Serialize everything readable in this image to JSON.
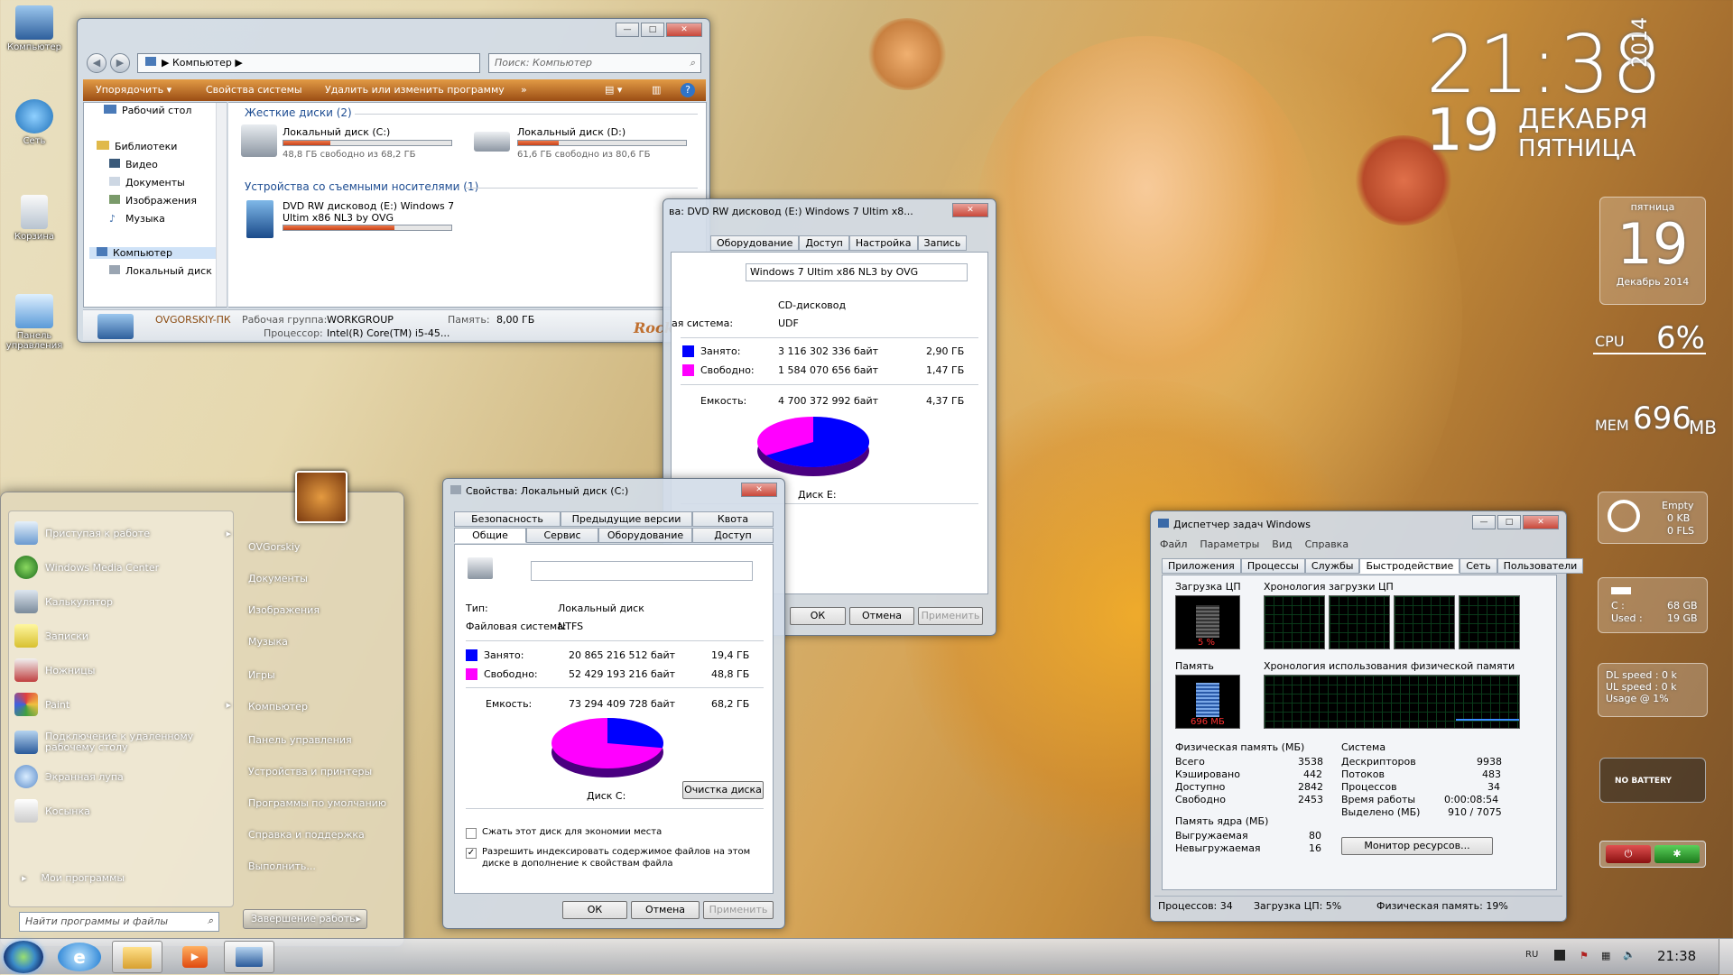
{
  "desktop": {
    "icons": [
      {
        "label": "Компьютер"
      },
      {
        "label": "Сеть"
      },
      {
        "label": "Корзина"
      },
      {
        "label": "Панель управления"
      }
    ],
    "clock": {
      "time": "21:38",
      "day": "19",
      "month": "ДЕКАБРЯ",
      "weekday": "ПЯТНИЦА",
      "year": "2014"
    },
    "calendar": {
      "weekday": "пятница",
      "day": "19",
      "month_year": "Декабрь 2014"
    },
    "cpu_gadget": {
      "label": "CPU",
      "value": "6%"
    },
    "mem_gadget": {
      "label": "MEM",
      "value": "696",
      "unit": "MB"
    },
    "recycle_gadget": {
      "line1": "Empty",
      "line2": "0 KB",
      "line3": "0 FLS"
    },
    "drive_gadget": {
      "line1": "C :",
      "line1_val": "68 GB",
      "line2": "Used :",
      "line2_val": "19 GB"
    },
    "net_gadget": {
      "line1": "DL speed : 0 k",
      "line2": "UL speed : 0 k",
      "line3": "Usage @ 1%"
    },
    "battery_gadget": {
      "label": "NO BATTERY"
    }
  },
  "explorer": {
    "address": "Компьютер",
    "search_placeholder": "Поиск: Компьютер",
    "toolbar": {
      "organize": "Упорядочить ▾",
      "system_props": "Свойства системы",
      "uninstall": "Удалить или изменить программу",
      "more": "»"
    },
    "nav": [
      "Рабочий стол",
      "Библиотеки",
      "Видео",
      "Документы",
      "Изображения",
      "Музыка",
      "Компьютер",
      "Локальный диск"
    ],
    "hdd_group": "Жесткие диски (2)",
    "drive_c": {
      "name": "Локальный диск (C:)",
      "free": "48,8 ГБ свободно из 68,2 ГБ",
      "used": 0.28
    },
    "drive_d": {
      "name": "Локальный диск (D:)",
      "free": "61,6 ГБ свободно из 80,6 ГБ",
      "used": 0.24
    },
    "removable_group": "Устройства со съемными носителями (1)",
    "dvd": {
      "name1": "DVD RW дисковод (E:) Windows 7",
      "name2": "Ultim x86 NL3 by OVG",
      "used": 0.66
    },
    "details": {
      "pc_name": "OVGORSKIY-ПК",
      "workgroup_label": "Рабочая группа:",
      "workgroup": "WORKGROUP",
      "memory_label": "Память:",
      "memory": "8,00 ГБ",
      "cpu_label": "Процессор:",
      "cpu": "Intel(R) Core(TM) i5-45..."
    },
    "brand": "Rocks"
  },
  "dvd_props": {
    "title": "ва: DVD RW дисковод (E:) Windows 7 Ultim x8...",
    "tabs": [
      "Оборудование",
      "Доступ",
      "Настройка",
      "Запись"
    ],
    "label_value": "Windows 7 Ultim x86 NL3 by OVG",
    "type": "CD-дисковод",
    "fs_label": "ая система:",
    "fs": "UDF",
    "used_label": "Занято:",
    "used_bytes": "3 116 302 336 байт",
    "used_gb": "2,90 ГБ",
    "free_label": "Свободно:",
    "free_bytes": "1 584 070 656 байт",
    "free_gb": "1,47 ГБ",
    "cap_label": "Емкость:",
    "cap_bytes": "4 700 372 992 байт",
    "cap_gb": "4,37 ГБ",
    "disk_label": "Диск E:",
    "used_fraction": 0.66,
    "ok": "ОК",
    "cancel": "Отмена",
    "apply": "Применить"
  },
  "c_props": {
    "title": "Свойства: Локальный диск (C:)",
    "tabs_top": [
      "Безопасность",
      "Предыдущие версии",
      "Квота"
    ],
    "tabs_bottom": [
      "Общие",
      "Сервис",
      "Оборудование",
      "Доступ"
    ],
    "type_label": "Тип:",
    "type": "Локальный диск",
    "fs_label": "Файловая система:",
    "fs": "NTFS",
    "used_label": "Занято:",
    "used_bytes": "20 865 216 512 байт",
    "used_gb": "19,4 ГБ",
    "free_label": "Свободно:",
    "free_bytes": "52 429 193 216 байт",
    "free_gb": "48,8 ГБ",
    "cap_label": "Емкость:",
    "cap_bytes": "73 294 409 728 байт",
    "cap_gb": "68,2 ГБ",
    "disk_label": "Диск C:",
    "cleanup": "Очистка диска",
    "used_fraction": 0.28,
    "compress": "Сжать этот диск для экономии места",
    "index1": "Разрешить индексировать содержимое файлов на этом",
    "index2": "диске в дополнение к свойствам файла",
    "ok": "ОК",
    "cancel": "Отмена",
    "apply": "Применить"
  },
  "taskmgr": {
    "title": "Диспетчер задач Windows",
    "menu": [
      "Файл",
      "Параметры",
      "Вид",
      "Справка"
    ],
    "tabs": [
      "Приложения",
      "Процессы",
      "Службы",
      "Быстродействие",
      "Сеть",
      "Пользователи"
    ],
    "cpu_load_label": "Загрузка ЦП",
    "cpu_load": "5 %",
    "cpu_hist_label": "Хронология загрузки ЦП",
    "mem_label": "Память",
    "mem_value": "696 МБ",
    "mem_hist_label": "Хронология использования физической памяти",
    "phys": {
      "title": "Физическая память (МБ)",
      "rows": [
        [
          "Всего",
          "3538"
        ],
        [
          "Кэшировано",
          "442"
        ],
        [
          "Доступно",
          "2842"
        ],
        [
          "Свободно",
          "2453"
        ]
      ]
    },
    "kernel": {
      "title": "Память ядра (МБ)",
      "rows": [
        [
          "Выгружаемая",
          "80"
        ],
        [
          "Невыгружаемая",
          "16"
        ]
      ]
    },
    "system": {
      "title": "Система",
      "rows": [
        [
          "Дескрипторов",
          "9938"
        ],
        [
          "Потоков",
          "483"
        ],
        [
          "Процессов",
          "34"
        ],
        [
          "Время работы",
          "0:00:08:54"
        ],
        [
          "Выделено (МБ)",
          "910 / 7075"
        ]
      ]
    },
    "monitor_btn": "Монитор ресурсов...",
    "status": {
      "procs": "Процессов: 34",
      "cpu": "Загрузка ЦП: 5%",
      "mem": "Физическая память: 19%"
    }
  },
  "start_menu": {
    "left": [
      "Приступая к работе",
      "Windows Media Center",
      "Калькулятор",
      "Записки",
      "Ножницы",
      "Paint",
      "Подключение к удаленному рабочему столу",
      "Экранная лупа",
      "Косынка"
    ],
    "all_programs": "Мои программы",
    "search_placeholder": "Найти программы и файлы",
    "right": [
      "OVGorskiy",
      "Документы",
      "Изображения",
      "Музыка",
      "Игры",
      "Компьютер",
      "Панель управления",
      "Устройства и принтеры",
      "Программы по умолчанию",
      "Справка и поддержка",
      "Выполнить..."
    ],
    "shutdown": "Завершение работы"
  },
  "taskbar": {
    "lang": "RU",
    "time": "21:38"
  }
}
